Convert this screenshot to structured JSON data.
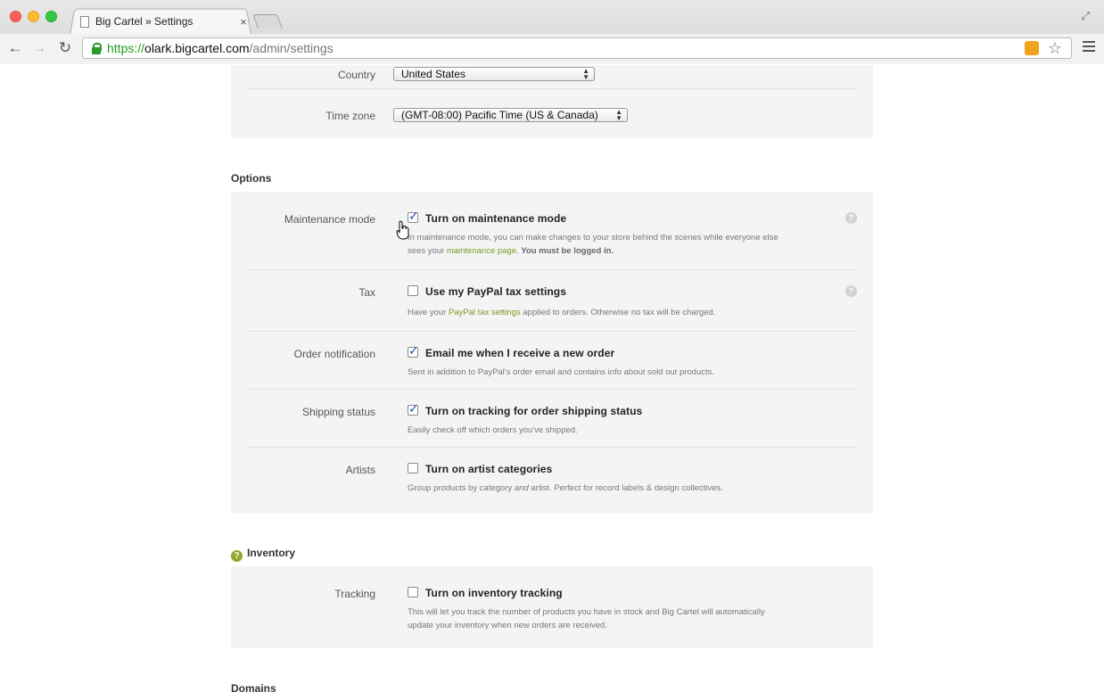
{
  "browser": {
    "tab_title": "Big Cartel » Settings",
    "tab_close": "×",
    "url_scheme": "https://",
    "url_host": "olark.bigcartel.com",
    "url_path": "/admin/settings"
  },
  "general": {
    "country_label": "Country",
    "country_value": "United States",
    "timezone_label": "Time zone",
    "timezone_value": "(GMT-08:00) Pacific Time (US & Canada)"
  },
  "options": {
    "title": "Options",
    "maintenance": {
      "label": "Maintenance mode",
      "checkbox_text": "Turn on maintenance mode",
      "checked": true,
      "desc_1": "In maintenance mode, you can make changes to your store behind the scenes while everyone else",
      "desc_2_pre": "sees your ",
      "desc_2_link": "maintenance page",
      "desc_2_mid": ". ",
      "desc_2_bold": "You must be logged in."
    },
    "tax": {
      "label": "Tax",
      "checkbox_text": "Use my PayPal tax settings",
      "checked": false,
      "desc_pre": "Have your ",
      "desc_link": "PayPal tax settings",
      "desc_post": " applied to orders. Otherwise no tax will be charged."
    },
    "order_notification": {
      "label": "Order notification",
      "checkbox_text": "Email me when I receive a new order",
      "checked": true,
      "desc": "Sent in addition to PayPal's order email and contains info about sold out products."
    },
    "shipping": {
      "label": "Shipping status",
      "checkbox_text": "Turn on tracking for order shipping status",
      "checked": true,
      "desc": "Easily check off which orders you've shipped."
    },
    "artists": {
      "label": "Artists",
      "checkbox_text": "Turn on artist categories",
      "checked": false,
      "desc_pre": "Group products by category ",
      "desc_em": "and",
      "desc_post": " artist. Perfect for record labels & design collectives."
    }
  },
  "inventory": {
    "title": "Inventory",
    "tracking": {
      "label": "Tracking",
      "checkbox_text": "Turn on inventory tracking",
      "checked": false,
      "desc_1": "This will let you track the number of products you have in stock and Big Cartel will automatically",
      "desc_2": "update your inventory when new orders are received."
    }
  },
  "domains": {
    "title": "Domains"
  }
}
